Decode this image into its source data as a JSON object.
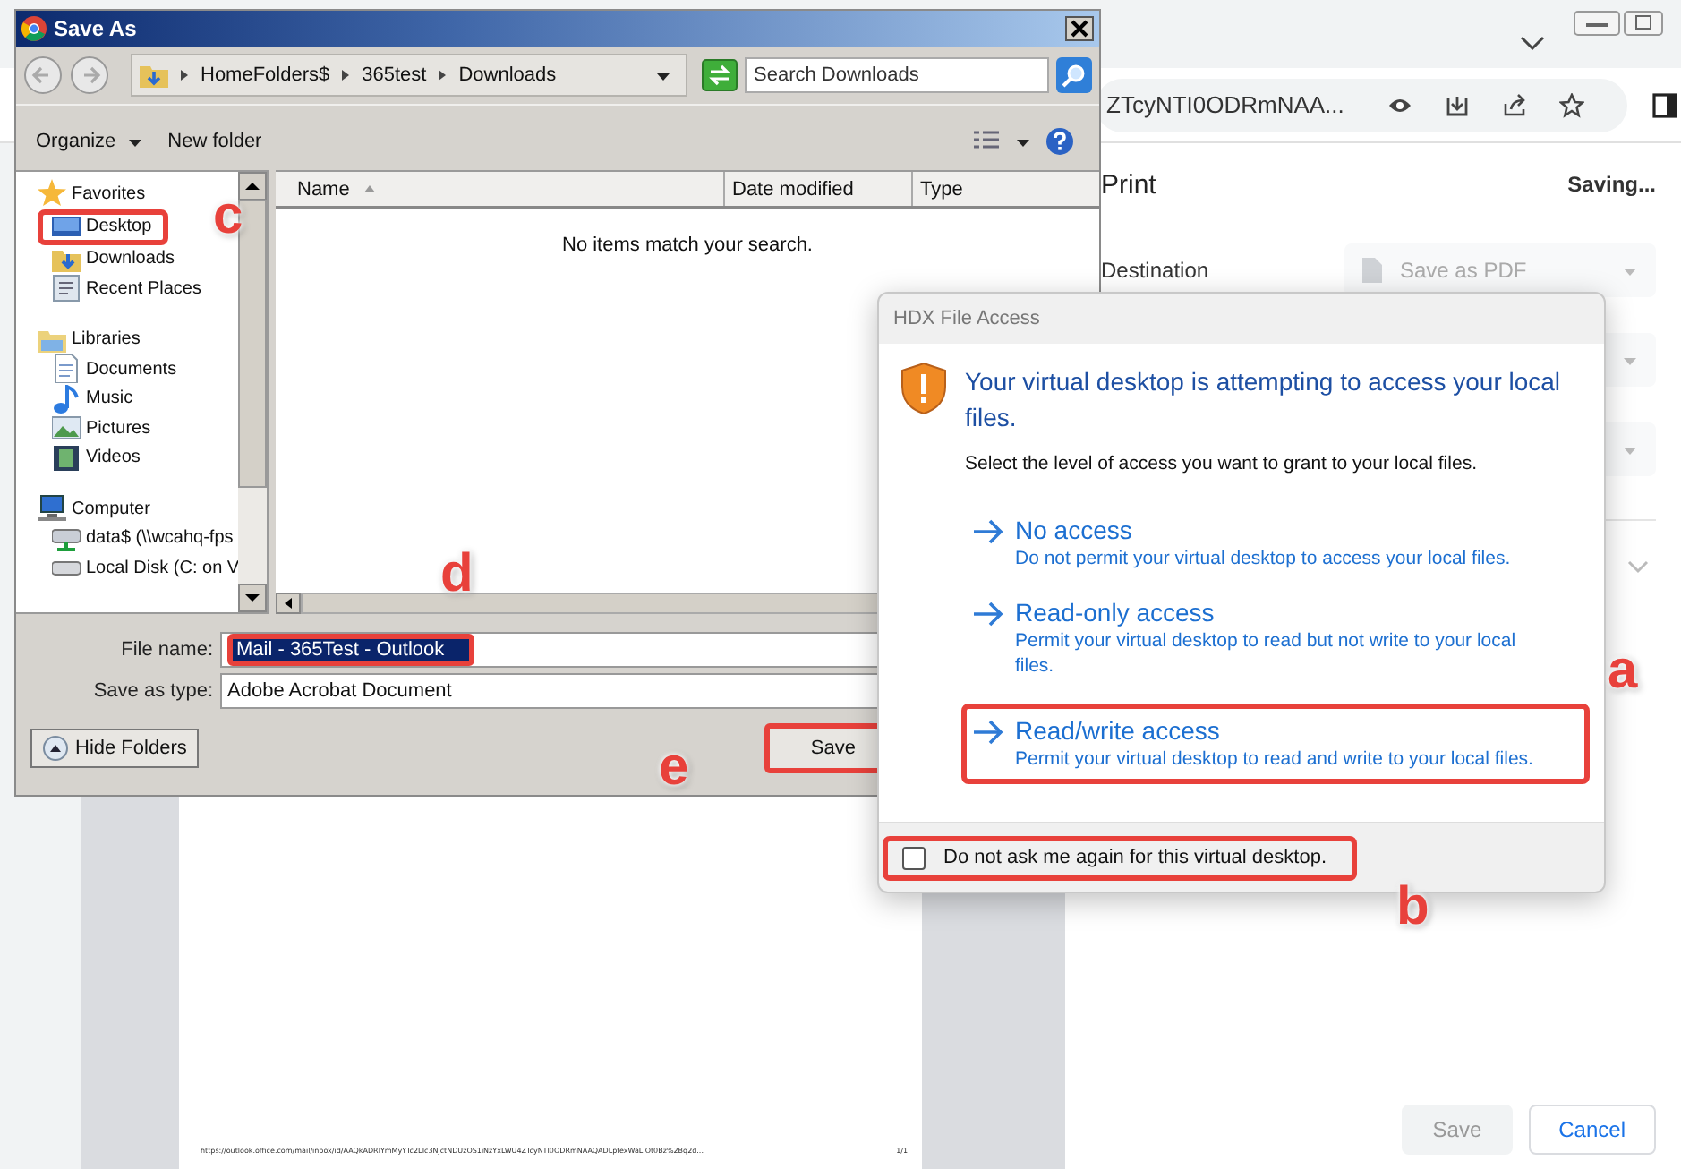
{
  "browser": {
    "address_text": "ZTcyNTI0ODRmNAA...",
    "print_panel": {
      "title": "Print",
      "status": "Saving...",
      "destination_label": "Destination",
      "destination_value": "Save as PDF",
      "buttons": [
        {
          "label": "Save",
          "disabled": true
        },
        {
          "label": "Cancel",
          "disabled": false
        }
      ]
    },
    "preview_footer": {
      "url": "https://outlook.office.com/mail/inbox/id/AAQkADRlYmMyYTc2LTc3NjctNDUzOS1iNzYxLWU4ZTcyNTI0ODRmNAAQADLpfexWaLIOt0Bz%2Bq2d...",
      "page": "1/1"
    }
  },
  "save_as": {
    "title": "Save As",
    "breadcrumb": [
      "HomeFolders$",
      "365test",
      "Downloads"
    ],
    "search_placeholder": "Search Downloads",
    "toolbar": [
      "Organize",
      "New folder"
    ],
    "nav_tree": [
      {
        "label": "Favorites",
        "kind": "star",
        "highlighted": false,
        "children": [
          {
            "label": "Desktop",
            "kind": "desktop",
            "highlighted": true
          },
          {
            "label": "Downloads",
            "kind": "downloads",
            "highlighted": false
          },
          {
            "label": "Recent Places",
            "kind": "recent",
            "highlighted": false
          }
        ]
      },
      {
        "label": "Libraries",
        "kind": "library",
        "highlighted": false,
        "children": [
          {
            "label": "Documents",
            "kind": "document",
            "highlighted": false
          },
          {
            "label": "Music",
            "kind": "music",
            "highlighted": false
          },
          {
            "label": "Pictures",
            "kind": "picture",
            "highlighted": false
          },
          {
            "label": "Videos",
            "kind": "video",
            "highlighted": false
          }
        ]
      },
      {
        "label": "Computer",
        "kind": "computer",
        "highlighted": false,
        "children": [
          {
            "label": "data$ (\\\\wcahq-fps",
            "kind": "netdrive",
            "highlighted": false
          },
          {
            "label": "Local Disk (C: on V",
            "kind": "disk",
            "highlighted": false
          }
        ]
      }
    ],
    "columns": [
      "Name",
      "Date modified",
      "Type"
    ],
    "empty_message": "No items match your search.",
    "file_name_label": "File name:",
    "file_name": {
      "value": "Mail - 365Test - Outlook",
      "highlighted": true
    },
    "type_label": "Save as type:",
    "save_as_type": "Adobe Acrobat Document",
    "hide_folders": "Hide Folders",
    "save_button": {
      "label": "Save",
      "highlighted": true
    }
  },
  "hdx": {
    "title": "HDX File Access",
    "heading": "Your virtual desktop is attempting to access your local files.",
    "prompt": "Select the level of access you want to grant to your local files.",
    "options": [
      {
        "title": "No access",
        "description": "Do not permit your virtual desktop to access your local files.",
        "highlighted": false
      },
      {
        "title": "Read-only access",
        "description": "Permit your virtual desktop to read but not write to your local files.",
        "highlighted": false
      },
      {
        "title": "Read/write access",
        "description": "Permit your virtual desktop to read and write to your local files.",
        "highlighted": true
      }
    ],
    "checkbox": {
      "label": "Do not ask me again for this virtual desktop.",
      "checked": false,
      "highlighted": true
    }
  },
  "callouts": [
    {
      "letter": "c"
    },
    {
      "letter": "d"
    },
    {
      "letter": "e"
    },
    {
      "letter": "a"
    },
    {
      "letter": "b"
    }
  ]
}
